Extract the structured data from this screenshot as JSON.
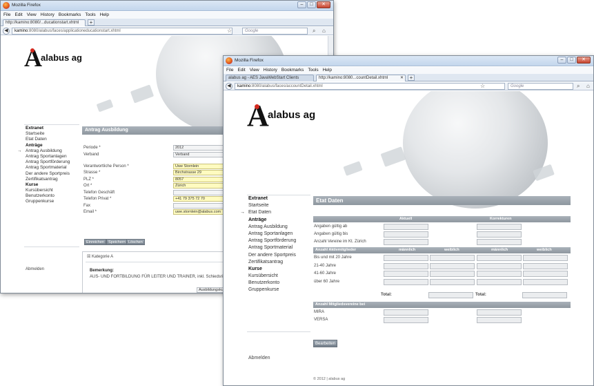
{
  "win1": {
    "title": "Mozilla Firefox",
    "menu": [
      "File",
      "Edit",
      "View",
      "History",
      "Bookmarks",
      "Tools",
      "Help"
    ],
    "tab": "http://kamino:8080/...ducationstart.xhtml",
    "url_host": "kamino",
    "url_rest": ":8080/alabus/faces/applicationeducationstart.xhtml",
    "search_placeholder": "Google",
    "logo": "alabus ag",
    "sidebar": [
      {
        "label": "Extranet",
        "head": true
      },
      {
        "label": "Startseite"
      },
      {
        "label": "Etat Daten"
      },
      {
        "label": "Anträge",
        "head": true
      },
      {
        "label": "Antrag Ausbildung",
        "current": true
      },
      {
        "label": "Antrag Sportanlagen"
      },
      {
        "label": "Antrag Sportförderung"
      },
      {
        "label": "Antrag Sportmaterial"
      },
      {
        "label": "Der andere Sportpreis"
      },
      {
        "label": "Zertifikatsantrag"
      },
      {
        "label": "Kurse",
        "head": true
      },
      {
        "label": "Kursübersicht"
      },
      {
        "label": "Benutzerkonto"
      },
      {
        "label": "Gruppenkurse"
      }
    ],
    "logout": "Abmelden",
    "section_title": "Antrag Ausbildung",
    "fields": [
      {
        "label": "Periode *",
        "value": "2012",
        "y": 0
      },
      {
        "label": "Verband",
        "value": "Verband",
        "y": 1
      },
      {
        "label": "Verantwortliche Person *",
        "value": "Uwe Stornlein",
        "y": 2.8,
        "yellow": true
      },
      {
        "label": "Strasse *",
        "value": "Birchstrasse 29",
        "y": 3.8,
        "yellow": true
      },
      {
        "label": "PLZ *",
        "value": "8057",
        "y": 4.8,
        "yellow": true
      },
      {
        "label": "Ort *",
        "value": "Zürich",
        "y": 5.8,
        "yellow": true
      },
      {
        "label": "Telefon Geschäft",
        "value": "",
        "y": 6.8
      },
      {
        "label": "Telefon Privat *",
        "value": "+41 79 375 72 70",
        "y": 7.8,
        "yellow": true
      },
      {
        "label": "Fax",
        "value": "",
        "y": 8.8
      },
      {
        "label": "Email *",
        "value": "uwe.stornlein@alabus.com",
        "y": 9.8,
        "yellow": true
      }
    ],
    "buttons": [
      "Einreichen",
      "Speichern",
      "Löschen"
    ],
    "category": "Kategorie A",
    "remark_label": "Bemerkung:",
    "remark_text": "AUS- UND FORTBILDUNG FÜR LEITER UND TRAINER, inkl. Schiedsrichter",
    "small_button": "Ausbildungskurs"
  },
  "win2": {
    "title": "Mozilla Firefox",
    "menu": [
      "File",
      "Edit",
      "View",
      "History",
      "Bookmarks",
      "Tools",
      "Help"
    ],
    "tab1": "alabus ag - AES JavaWebStart Clients",
    "tab2": "http://kamino:8080...countDetail.xhtml",
    "url_host": "kamino",
    "url_rest": ":8080/alabus/faces/accountDetail.xhtml",
    "search_placeholder": "Google",
    "logo": "alabus ag",
    "sidebar": [
      {
        "label": "Extranet",
        "head": true
      },
      {
        "label": "Startseite"
      },
      {
        "label": "Etat Daten",
        "current": true
      },
      {
        "label": "Anträge",
        "head": true
      },
      {
        "label": "Antrag Ausbildung"
      },
      {
        "label": "Antrag Sportanlagen"
      },
      {
        "label": "Antrag Sportförderung"
      },
      {
        "label": "Antrag Sportmaterial"
      },
      {
        "label": "Der andere Sportpreis"
      },
      {
        "label": "Zertifikatsantrag"
      },
      {
        "label": "Kurse",
        "head": true
      },
      {
        "label": "Kursübersicht"
      },
      {
        "label": "Benutzerkonto"
      },
      {
        "label": "Gruppenkurse"
      }
    ],
    "logout": "Abmelden",
    "section_title": "Etat Daten",
    "col_aktuell": "Aktuell",
    "col_korrekturen": "Korrekturen",
    "rows_top": [
      "Angaben gültig ab",
      "Angaben gültig bis",
      "Anzahl Vereine im Kt. Zürich"
    ],
    "members_header": "Anzahl Aktivmitglieder",
    "maennlich": "männlich",
    "weiblich": "weiblich",
    "age_rows": [
      "Bis und mit 20 Jahre",
      "21-40 Jahre",
      "41-60 Jahre",
      "über 60 Jahre"
    ],
    "total": "Total:",
    "membership_header": "Anzahl Mitgliedsvereine bei",
    "member_rows": [
      "MIRA",
      "VERSA"
    ],
    "edit_button": "Bearbeiten",
    "footer": "© 2012 | alabus ag"
  }
}
